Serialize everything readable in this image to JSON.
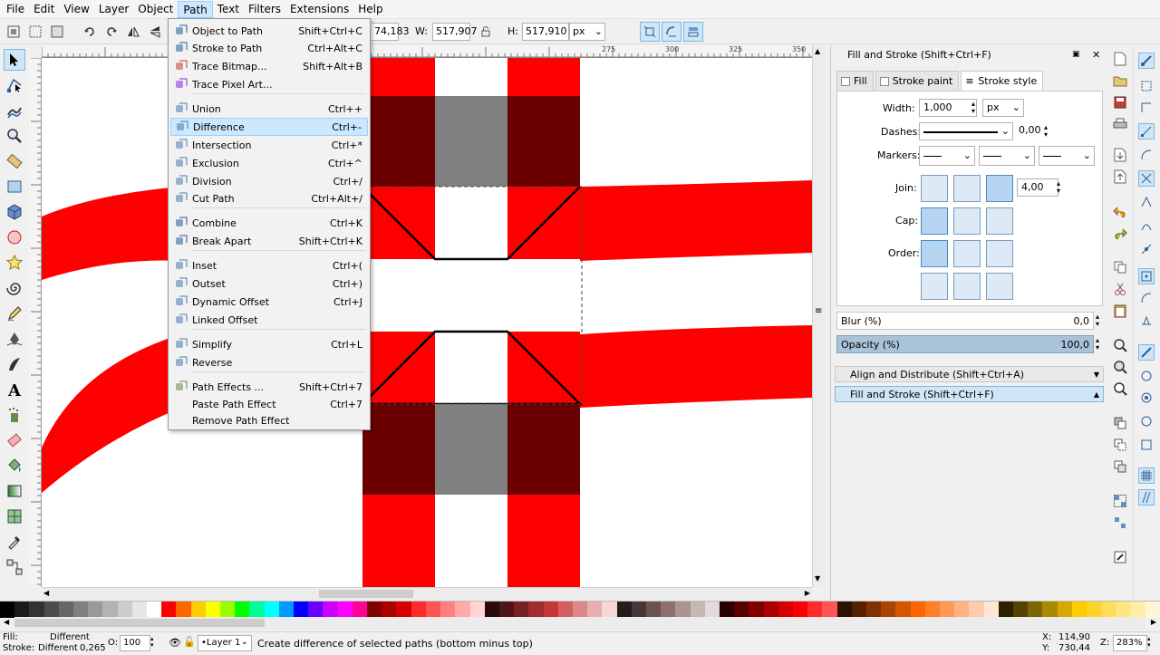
{
  "menubar": [
    "File",
    "Edit",
    "View",
    "Layer",
    "Object",
    "Path",
    "Text",
    "Filters",
    "Extensions",
    "Help"
  ],
  "controls": {
    "x_value": "74,183",
    "w_label": "W:",
    "w_value": "517,907",
    "h_label": "H:",
    "h_value": "517,910",
    "unit": "px"
  },
  "ruler_labels": [
    "275",
    "300",
    "325",
    "350",
    "375",
    "400",
    "425"
  ],
  "path_menu": {
    "items": [
      {
        "label": "Object to Path",
        "shortcut": "Shift+Ctrl+C",
        "icon": "object-to-path-icon"
      },
      {
        "label": "Stroke to Path",
        "shortcut": "Ctrl+Alt+C",
        "icon": "stroke-to-path-icon"
      },
      {
        "label": "Trace Bitmap...",
        "shortcut": "Shift+Alt+B",
        "icon": "trace-bitmap-icon"
      },
      {
        "label": "Trace Pixel Art...",
        "shortcut": "",
        "icon": "trace-pixel-art-icon"
      },
      {
        "label": "Union",
        "shortcut": "Ctrl++",
        "icon": "union-icon"
      },
      {
        "label": "Difference",
        "shortcut": "Ctrl+-",
        "icon": "difference-icon"
      },
      {
        "label": "Intersection",
        "shortcut": "Ctrl+*",
        "icon": "intersection-icon"
      },
      {
        "label": "Exclusion",
        "shortcut": "Ctrl+^",
        "icon": "exclusion-icon"
      },
      {
        "label": "Division",
        "shortcut": "Ctrl+/",
        "icon": "division-icon"
      },
      {
        "label": "Cut Path",
        "shortcut": "Ctrl+Alt+/",
        "icon": "cut-path-icon"
      },
      {
        "label": "Combine",
        "shortcut": "Ctrl+K",
        "icon": "combine-icon"
      },
      {
        "label": "Break Apart",
        "shortcut": "Shift+Ctrl+K",
        "icon": "break-apart-icon"
      },
      {
        "label": "Inset",
        "shortcut": "Ctrl+(",
        "icon": "inset-icon"
      },
      {
        "label": "Outset",
        "shortcut": "Ctrl+)",
        "icon": "outset-icon"
      },
      {
        "label": "Dynamic Offset",
        "shortcut": "Ctrl+J",
        "icon": "dynamic-offset-icon"
      },
      {
        "label": "Linked Offset",
        "shortcut": "",
        "icon": "linked-offset-icon"
      },
      {
        "label": "Simplify",
        "shortcut": "Ctrl+L",
        "icon": "simplify-icon"
      },
      {
        "label": "Reverse",
        "shortcut": "",
        "icon": "reverse-icon"
      },
      {
        "label": "Path Effects ...",
        "shortcut": "Shift+Ctrl+7",
        "icon": "path-effects-icon"
      },
      {
        "label": "Paste Path Effect",
        "shortcut": "Ctrl+7",
        "icon": ""
      },
      {
        "label": "Remove Path Effect",
        "shortcut": "",
        "icon": ""
      }
    ]
  },
  "dock": {
    "title": "Fill and Stroke (Shift+Ctrl+F)",
    "tabs": [
      "Fill",
      "Stroke paint",
      "Stroke style"
    ],
    "width_label": "Width:",
    "width_value": "1,000",
    "width_unit": "px",
    "dashes_label": "Dashes:",
    "dashes_value": "0,00",
    "markers_label": "Markers:",
    "join_label": "Join:",
    "join_value": "4,00",
    "cap_label": "Cap:",
    "order_label": "Order:",
    "blur_label": "Blur (%)",
    "blur_value": "0,0",
    "opacity_label": "Opacity (%)",
    "opacity_value": "100,0",
    "collapsed_1": "Align and Distribute (Shift+Ctrl+A)",
    "collapsed_2": "Fill and Stroke (Shift+Ctrl+F)"
  },
  "status": {
    "fill_label": "Fill:",
    "fill_value": "Different",
    "stroke_label": "Stroke:",
    "stroke_value": "Different",
    "stroke_width": "0,265",
    "opacity_label": "O:",
    "opacity_value": "100",
    "layer": "Layer 1",
    "message": "Create difference of selected paths (bottom minus top)",
    "x_label": "X:",
    "x_value": "114,90",
    "y_label": "Y:",
    "y_value": "730,44",
    "zoom_label": "Z:",
    "zoom_value": "283%"
  },
  "colors": {
    "accent": "#cce8ff",
    "red": "#ff0000",
    "dark_red": "#6b0000",
    "gray": "#808080"
  },
  "palette": [
    "#000000",
    "#1a1a1a",
    "#333333",
    "#4d4d4d",
    "#666666",
    "#808080",
    "#999999",
    "#b3b3b3",
    "#cccccc",
    "#e6e6e6",
    "#ffffff",
    "#ff0000",
    "#ff6600",
    "#ffcc00",
    "#ffff00",
    "#99ff00",
    "#00ff00",
    "#00ff99",
    "#00ffff",
    "#0099ff",
    "#0000ff",
    "#6600ff",
    "#cc00ff",
    "#ff00ff",
    "#ff0099",
    "#800000",
    "#aa0000",
    "#d40000",
    "#ff2a2a",
    "#ff5555",
    "#ff8080",
    "#ffaaaa",
    "#ffd5d5",
    "#280b0b",
    "#501616",
    "#782121",
    "#a02c2c",
    "#c83737",
    "#d35f5f",
    "#de8787",
    "#e9afaf",
    "#f4d7d7",
    "#241c1c",
    "#483737",
    "#6c5353",
    "#916f6f",
    "#ac9393",
    "#c8b7b7",
    "#e3dbdb",
    "#280000",
    "#550000",
    "#800000",
    "#aa0000",
    "#d40000",
    "#ff0000",
    "#ff2a2a",
    "#ff5555",
    "#2b1100",
    "#552200",
    "#803300",
    "#aa4400",
    "#d45500",
    "#ff6600",
    "#ff7f2a",
    "#ff9955",
    "#ffb380",
    "#ffccaa",
    "#ffe6d5",
    "#2b2200",
    "#554400",
    "#806600",
    "#aa8800",
    "#d4aa00",
    "#ffcc00",
    "#ffd42a",
    "#ffdd55",
    "#ffe680",
    "#ffeeaa",
    "#fff6d5"
  ]
}
